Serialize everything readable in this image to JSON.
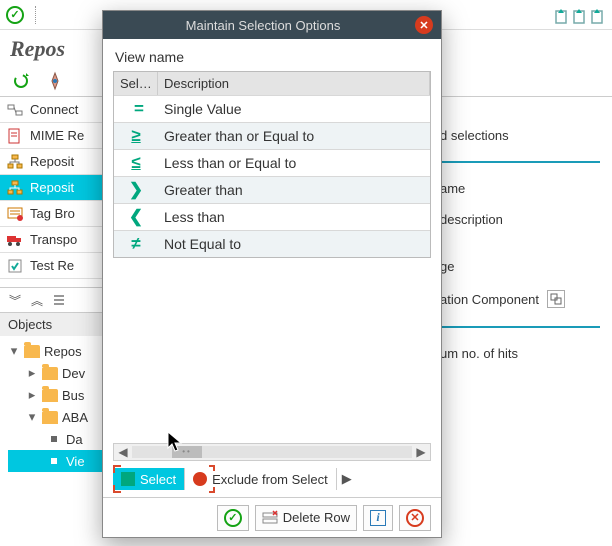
{
  "top": {
    "title_partial": "Repos"
  },
  "nav": {
    "items": [
      {
        "label": "Connect"
      },
      {
        "label": "MIME Re"
      },
      {
        "label": "Reposit"
      },
      {
        "label": "Reposit"
      },
      {
        "label": "Tag Bro"
      },
      {
        "label": "Transpo"
      },
      {
        "label": "Test Re"
      }
    ]
  },
  "objects": {
    "header": "Objects",
    "tree": [
      {
        "label": "Repos",
        "depth": 0,
        "expanded": true,
        "type": "folder"
      },
      {
        "label": "Dev",
        "depth": 1,
        "expanded": false,
        "type": "folder"
      },
      {
        "label": "Bus",
        "depth": 1,
        "expanded": false,
        "type": "folder"
      },
      {
        "label": "ABA",
        "depth": 1,
        "expanded": true,
        "type": "folder"
      },
      {
        "label": "Da",
        "depth": 2,
        "type": "leaf"
      },
      {
        "label": "Vie",
        "depth": 2,
        "type": "leaf",
        "selected": true
      }
    ]
  },
  "right": {
    "items": [
      "d selections",
      "ame",
      "description",
      "ge",
      "ation Component"
    ],
    "hits_label": "um no. of hits"
  },
  "dialog": {
    "title": "Maintain Selection Options",
    "view_label": "View name",
    "col_sel": "Sel…",
    "col_desc": "Description",
    "options": [
      {
        "glyph": "=",
        "label": "Single Value"
      },
      {
        "glyph": "≥",
        "label": "Greater than or Equal to"
      },
      {
        "glyph": "≤",
        "label": "Less than or Equal to"
      },
      {
        "glyph": "❯",
        "label": "Greater than"
      },
      {
        "glyph": "❮",
        "label": "Less than"
      },
      {
        "glyph": "≠",
        "label": "Not Equal to"
      }
    ],
    "tab_select": "Select",
    "tab_exclude": "Exclude from Select",
    "footer": {
      "delete_row": "Delete Row",
      "info_glyph": "i"
    }
  }
}
